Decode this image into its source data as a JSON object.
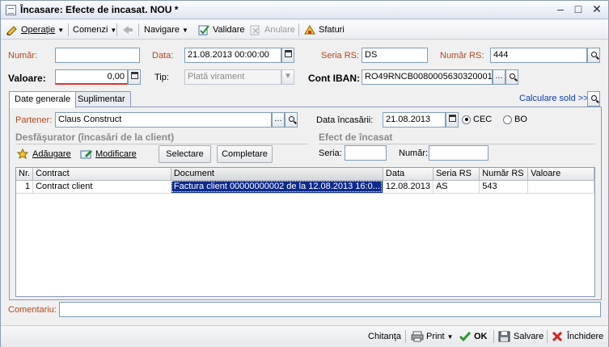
{
  "window": {
    "title": "Încasare: Efecte de incasat. NOU *"
  },
  "toolbar": {
    "operatie": "Operaţie",
    "comenzi": "Comenzi",
    "navigare": "Navigare",
    "validare": "Validare",
    "anulare": "Anulare",
    "sfaturi": "Sfaturi"
  },
  "header": {
    "numar_label": "Număr:",
    "numar_value": "",
    "data_label": "Data:",
    "data_value": "21.08.2013 00:00:00",
    "seria_rs_label": "Seria RS:",
    "seria_rs_value": "DS",
    "numar_rs_label": "Număr RS:",
    "numar_rs_value": "444",
    "valoare_label": "Valoare:",
    "valoare_value": "0,00",
    "tip_label": "Tip:",
    "tip_value": "Plată virament",
    "cont_iban_label": "Cont IBAN:",
    "cont_iban_value": "RO49RNCB0080005630320001\\"
  },
  "tabs": [
    {
      "label": "Date generale",
      "active": true
    },
    {
      "label": "Suplimentar",
      "active": false
    }
  ],
  "calculare_sold": "Calculare sold >>",
  "general": {
    "partener_label": "Partener:",
    "partener_value": "Claus Construct",
    "data_incasarii_label": "Data încasării:",
    "data_incasarii_value": "21.08.2013",
    "cec_label": "CEC",
    "bo_label": "BO",
    "desfasurator_title": "Desfăşurator (încasări de la client)",
    "efect_title": "Efect de încasat",
    "adaugare": "Adăugare",
    "modificare": "Modificare",
    "selectare": "Selectare",
    "completare": "Completare",
    "seria_label": "Seria:",
    "seria_value": "",
    "numar_label": "Număr:",
    "numar_value": ""
  },
  "grid": {
    "columns": [
      "Nr.",
      "Contract",
      "Document",
      "Data",
      "Seria RS",
      "Număr RS",
      "Valoare"
    ],
    "rows": [
      [
        "1",
        "Contract client",
        "Factura client 00000000002 de la 12.08.2013 16:0...",
        "12.08.2013",
        "AS",
        "543",
        ""
      ]
    ]
  },
  "comentariu": {
    "label": "Comentariu:",
    "value": ""
  },
  "statusbar": {
    "chitanta": "Chitanţa",
    "print": "Print",
    "ok": "OK",
    "salvare": "Salvare",
    "inchidere": "Închidere"
  }
}
